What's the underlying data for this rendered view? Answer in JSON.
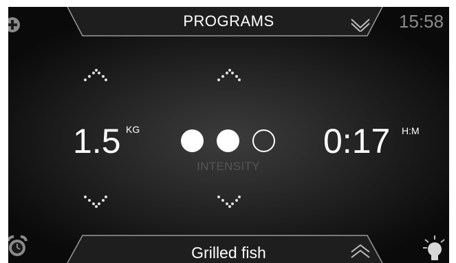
{
  "header": {
    "title": "PROGRAMS",
    "time": "15:58",
    "add_icon": "plus-circle-icon",
    "collapse_icon": "chevron-down-icon"
  },
  "weight": {
    "value": "1.5",
    "unit": "KG"
  },
  "intensity": {
    "label": "INTENSITY",
    "level": 2,
    "max": 3
  },
  "duration": {
    "value": "0:17",
    "unit": "H:M"
  },
  "footer": {
    "program_name": "Grilled fish",
    "alarm_icon": "alarm-clock-icon",
    "light_icon": "light-bulb-icon",
    "expand_icon": "chevron-up-icon"
  },
  "colors": {
    "background": "#0a0a0a",
    "text": "#ffffff",
    "muted": "#8a8a8a",
    "label": "#555555"
  }
}
